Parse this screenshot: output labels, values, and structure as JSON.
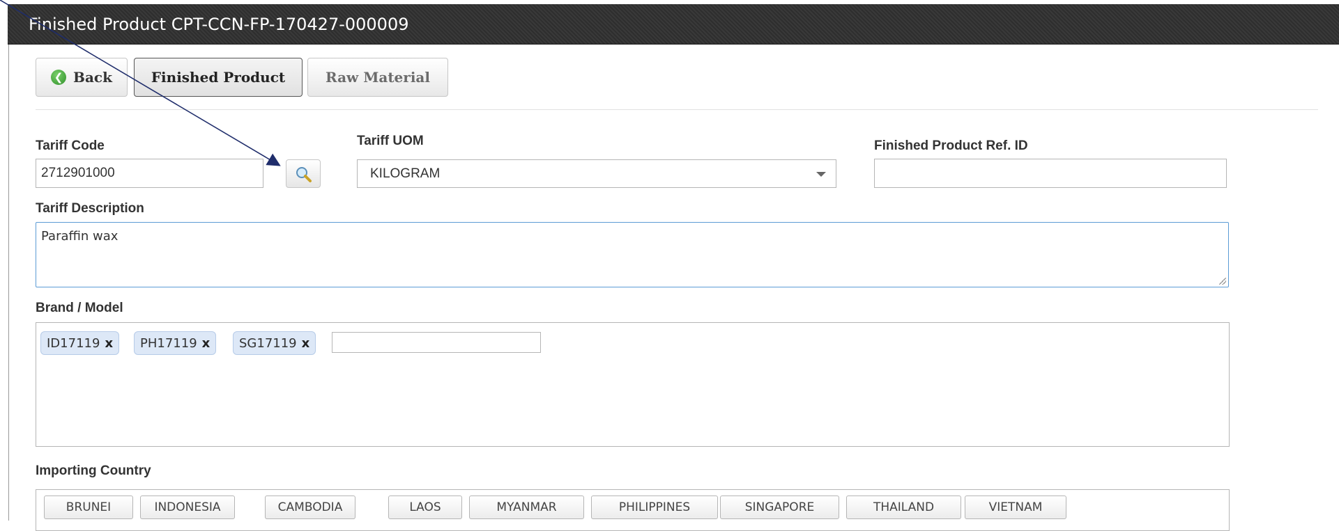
{
  "window": {
    "title": "Finished Product CPT-CCN-FP-170427-000009"
  },
  "toolbar": {
    "back_label": "Back",
    "finished_product_label": "Finished Product",
    "raw_material_label": "Raw Material"
  },
  "form": {
    "tariff_code": {
      "label": "Tariff Code",
      "value": "2712901000"
    },
    "tariff_uom": {
      "label": "Tariff UOM",
      "value": "KILOGRAM"
    },
    "ref_id": {
      "label": "Finished Product Ref. ID",
      "value": ""
    },
    "tariff_description": {
      "label": "Tariff Description",
      "value": "Paraffin wax"
    },
    "brand_model": {
      "label": "Brand / Model",
      "tags": [
        "ID17119",
        "PH17119",
        "SG17119"
      ],
      "remove_glyph": "x"
    },
    "importing_country": {
      "label": "Importing Country",
      "options": [
        "BRUNEI",
        "INDONESIA",
        "CAMBODIA",
        "LAOS",
        "MYANMAR",
        "PHILIPPINES",
        "SINGAPORE",
        "THAILAND",
        "VIETNAM"
      ]
    }
  },
  "icons": {
    "back": "circle-arrow-left-icon",
    "search": "magnifier-icon",
    "dropdown": "chevron-down-icon"
  },
  "colors": {
    "titlebar": "#333333",
    "tag_bg": "#dde8f7",
    "focus_border": "#5b9bd5",
    "back_icon": "#3a9a33",
    "annotation_arrow": "#1f2d6b"
  }
}
